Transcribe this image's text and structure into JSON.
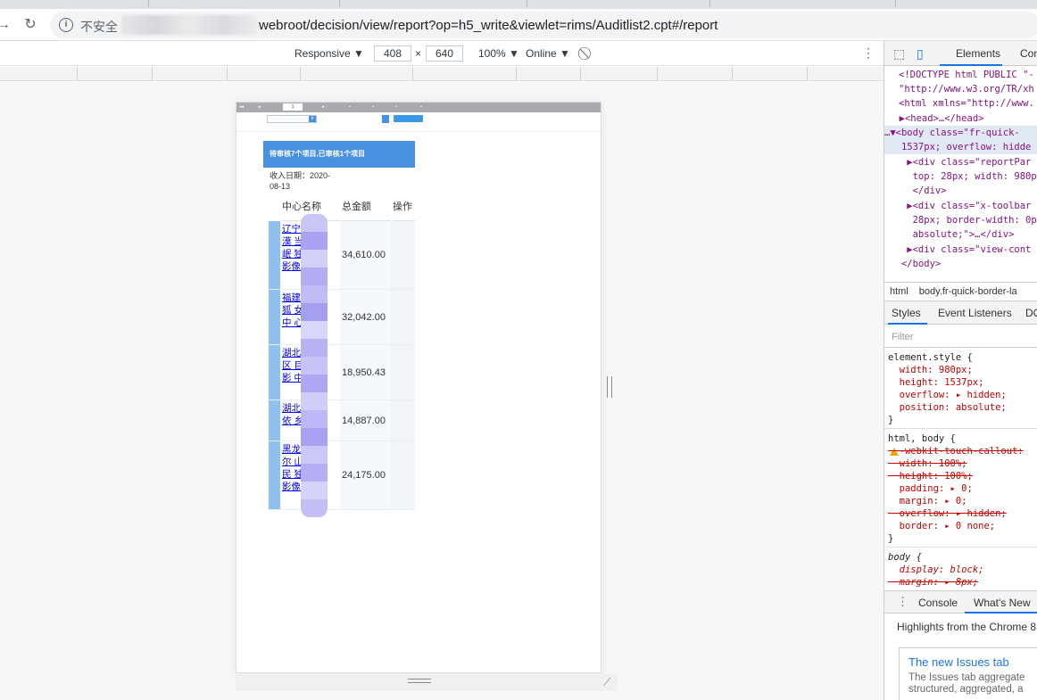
{
  "browser": {
    "insecure_label": "不安全",
    "url": "webroot/decision/view/report?op=h5_write&viewlet=rims/Auditlist2.cpt#/report"
  },
  "device_toolbar": {
    "mode": "Responsive ▼",
    "width": "408",
    "times": "×",
    "height": "640",
    "zoom": "100% ▼",
    "network": "Online ▼"
  },
  "report": {
    "banner": "待审核7个项目,已审核1个项目",
    "date_line1": "收入日期：2020-",
    "date_line2": "08-13",
    "headers": [
      "中心名称",
      "总金额",
      "操作"
    ],
    "rows": [
      {
        "name": "辽宁 所 宾漠 当 县人 岷 独立 型 影像",
        "amount": "34,610.00"
      },
      {
        "name": "福建 二 脉狐 女 托型 中 心",
        "amount": "32,042.00"
      },
      {
        "name": "湖北 厂 库区 目 依托 影 中心",
        "amount": "18,950.43"
      },
      {
        "name": "湖北 像 立依 乡 像中",
        "amount": "14,887.00"
      },
      {
        "name": "黑龙 后 哈尔 山 区人 民 独立 型 影像",
        "amount": "24,175.00"
      }
    ]
  },
  "devtools": {
    "tabs": {
      "elements": "Elements",
      "console_short": "Con"
    },
    "code": [
      "<!DOCTYPE html PUBLIC \"-",
      "\"http://www.w3.org/TR/xh",
      "<html xmlns=\"http://www.",
      "  ▶<head>…</head>",
      "…▼<body class=\"fr-quick-",
      "   1537px; overflow: hidde",
      "    ▶<div class=\"reportPar",
      "     top: 28px; width: 980p",
      "     </div>",
      "    ▶<div class=\"x-toolbar",
      "     28px; border-width: 0p",
      "     absolute;\">…</div>",
      "    ▶<div class=\"view-cont",
      "   </body>"
    ],
    "crumbs": [
      "html",
      "body.fr-quick-border-la"
    ],
    "subtabs": [
      "Styles",
      "Event Listeners",
      "DO"
    ],
    "filter_placeholder": "Filter",
    "styles": [
      "element.style {",
      "  width: 980px;",
      "  height: 1537px;",
      "  overflow: ▸ hidden;",
      "  position: absolute;",
      "}",
      "html, body {",
      "  -webkit-touch-callout:",
      "  width: 100%;",
      "  height: 100%;",
      "  padding: ▸ 0;",
      "  margin: ▸ 0;",
      "  overflow: ▸ hidden;",
      "  border: ▸ 0 none;",
      "}",
      "body {",
      "  display: block;",
      "  margin: ▸ 8px;"
    ],
    "drawer": {
      "console": "Console",
      "whats_new": "What's New"
    },
    "highlights": "Highlights from the Chrome 8",
    "issues_title": "The new Issues tab",
    "issues_desc1": "The Issues tab aggregate",
    "issues_desc2": "structured, aggregated, a"
  }
}
